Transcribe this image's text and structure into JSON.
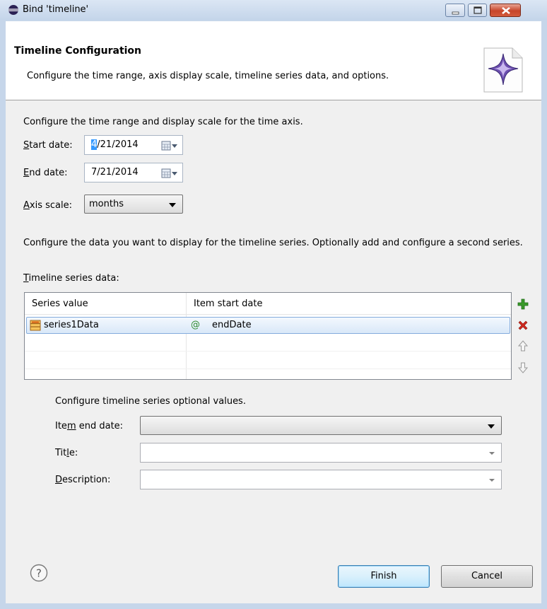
{
  "window": {
    "title": "Bind 'timeline'"
  },
  "header": {
    "title": "Timeline Configuration",
    "description": "Configure the time range, axis display scale, timeline series data, and options."
  },
  "time_section": {
    "intro": "Configure the time range and display scale for the time axis.",
    "start_date": {
      "mnemonic": "S",
      "label_rest": "tart date:",
      "value_selected": "4",
      "value_rest": "/21/2014"
    },
    "end_date": {
      "mnemonic": "E",
      "label_rest": "nd date:",
      "value": "7/21/2014"
    },
    "axis_scale": {
      "mnemonic": "A",
      "label_rest": "xis scale:",
      "value": "months"
    }
  },
  "series_section": {
    "intro": "Configure the data you want to display for the timeline series. Optionally add and configure a second series.",
    "table_label_mnemonic": "T",
    "table_label_rest": "imeline series data:",
    "columns": [
      "Series value",
      "Item start date"
    ],
    "rows": [
      {
        "series_value": "series1Data",
        "item_start_date": "endDate",
        "date_prefix": "@"
      }
    ]
  },
  "optional_section": {
    "intro": "Configure timeline series optional values.",
    "item_end_date": {
      "pre": "Ite",
      "mnemonic": "m",
      "post": " end date:",
      "value": ""
    },
    "title": {
      "pre": "Tit",
      "mnemonic": "l",
      "post": "e:",
      "value": ""
    },
    "description": {
      "pre": "",
      "mnemonic": "D",
      "post": "escription:",
      "value": ""
    }
  },
  "buttons": {
    "finish": "Finish",
    "cancel": "Cancel"
  },
  "icons": {
    "app": "eclipse-icon",
    "add": "add-icon",
    "remove": "remove-icon",
    "up": "move-up-icon",
    "down": "move-down-icon",
    "help": "help-icon"
  },
  "colors": {
    "selection": "#3399ff",
    "add": "#3a9a2a",
    "remove": "#d0281e"
  }
}
